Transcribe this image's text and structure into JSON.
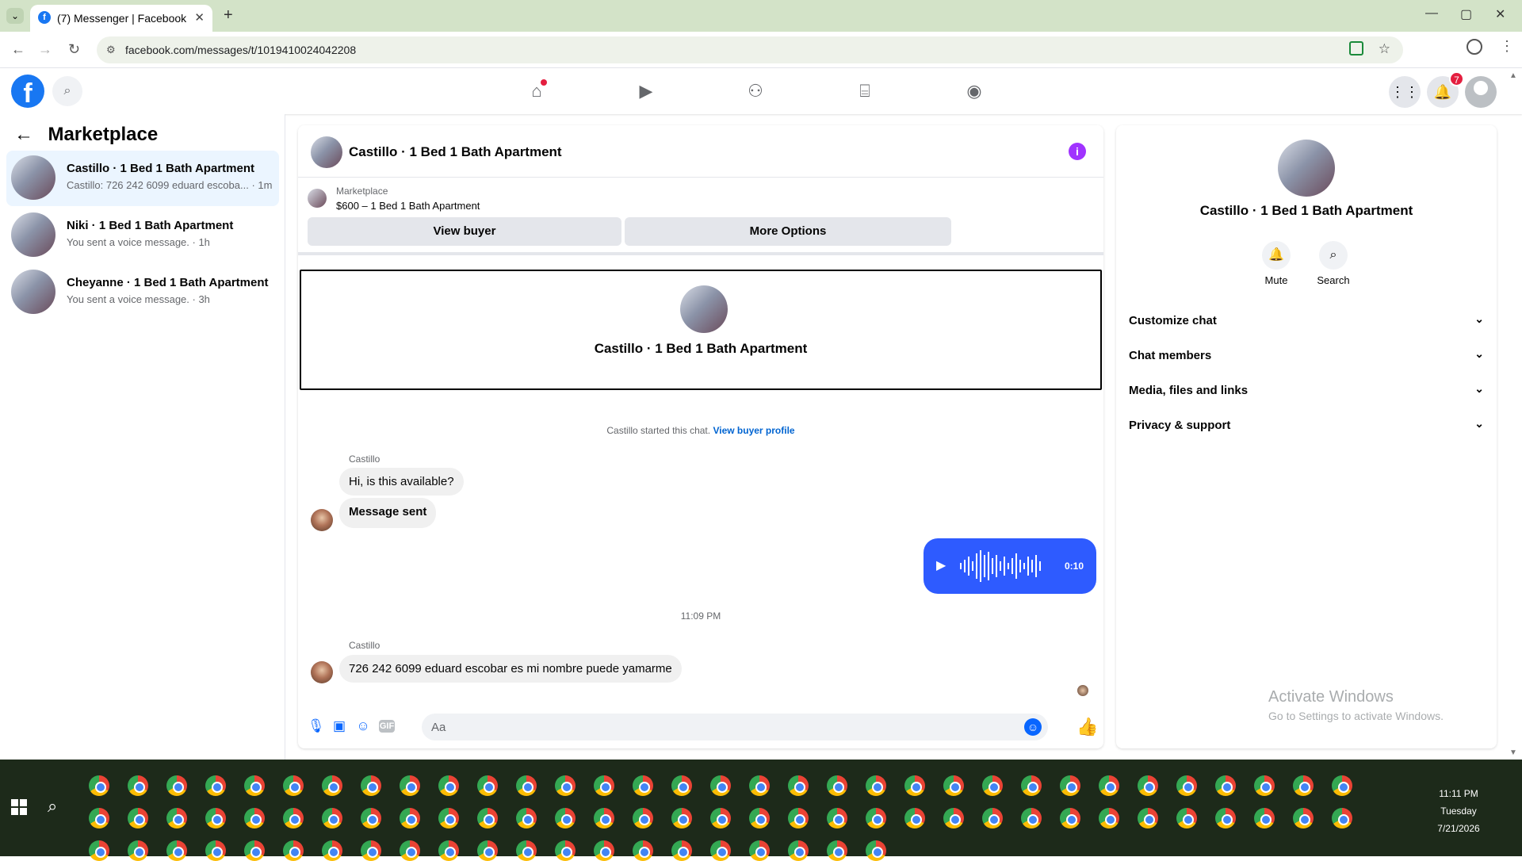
{
  "browser": {
    "tab_title": "(7) Messenger | Facebook",
    "tab_close": "✕",
    "new_tab": "+",
    "url": "facebook.com/messages/t/1019410024042208",
    "back": "←",
    "forward": "→",
    "reload": "↻",
    "minimize": "—",
    "maximize": "▢",
    "close": "✕"
  },
  "fb_header": {
    "logo": "f",
    "notifications_count": "7",
    "nav_icons": [
      "home-icon",
      "video-icon",
      "friends-icon",
      "marketplace-icon",
      "gaming-icon"
    ]
  },
  "sidebar": {
    "back": "←",
    "title": "Marketplace",
    "conversations": [
      {
        "name": "Castillo · 1 Bed 1 Bath Apartment",
        "preview": "Castillo: 726 242 6099 eduard escoba... · 1m",
        "active": true
      },
      {
        "name": "Niki · 1 Bed 1 Bath Apartment",
        "preview": "You sent a voice message. · 1h",
        "active": false
      },
      {
        "name": "Cheyanne · 1 Bed 1 Bath Apartment",
        "preview": "You sent a voice message. · 3h",
        "active": false
      }
    ]
  },
  "chat": {
    "title": "Castillo · 1 Bed 1 Bath Apartment",
    "info_icon": "i",
    "marketplace": {
      "label": "Marketplace",
      "listing": "$600 – 1 Bed 1 Bath Apartment",
      "view_buyer": "View buyer",
      "more_options": "More Options"
    },
    "intro_name": "Castillo · 1 Bed 1 Bath Apartment",
    "started_text": "Castillo started this chat.",
    "started_link": "View buyer profile",
    "messages": [
      {
        "sender": "Castillo",
        "text": "Hi, is this available?"
      },
      {
        "text": "Message sent"
      },
      {
        "text": "726 242 6099 eduard escobar es mi nombre puede yamarme"
      }
    ],
    "voice": {
      "play": "▶",
      "duration": "0:10"
    },
    "timestamp": "11:09 PM",
    "sender2": "Castillo",
    "composer_placeholder": "Aa"
  },
  "right_panel": {
    "name": "Castillo · 1 Bed 1 Bath Apartment",
    "mute": "Mute",
    "search": "Search",
    "rows": [
      "Customize chat",
      "Chat members",
      "Media, files and links",
      "Privacy & support"
    ]
  },
  "watermark": {
    "line1": "Activate Windows",
    "line2": "Go to Settings to activate Windows."
  },
  "taskbar": {
    "time": "11:11 PM",
    "day": "Tuesday",
    "date": "7/21/2026"
  },
  "colors": {
    "accent": "#0866ff",
    "voice": "#2e5bff",
    "active_bg": "#ebf5ff"
  }
}
